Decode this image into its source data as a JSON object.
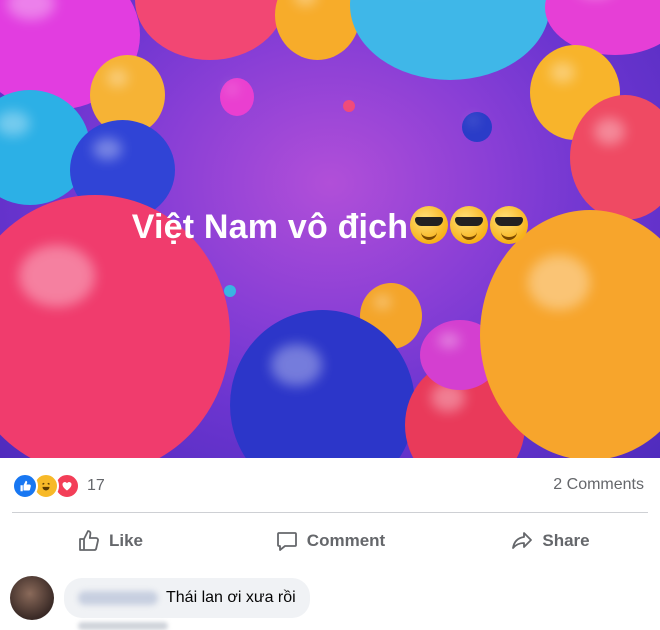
{
  "post": {
    "text": "Việt Nam vô địch",
    "emojis": [
      "sunglasses-emoji",
      "sunglasses-emoji",
      "sunglasses-emoji"
    ],
    "background": "balloons-gradient"
  },
  "reactions": {
    "icons": [
      "like",
      "haha",
      "love"
    ],
    "count": "17",
    "comments_count": "2 Comments"
  },
  "actions": {
    "like": "Like",
    "comment": "Comment",
    "share": "Share"
  },
  "comment": {
    "text": "Thái lan ơi xưa rồi"
  },
  "colors": {
    "like_blue": "#1877f2",
    "haha_yellow": "#f7b928",
    "love_red": "#f33e58",
    "meta_gray": "#65676b"
  }
}
